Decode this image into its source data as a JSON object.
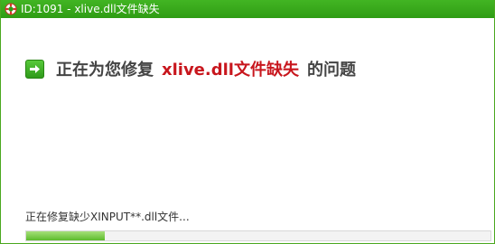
{
  "window": {
    "title": "ID:1091 - xlive.dll文件缺失",
    "app_icon": "lifebuoy-icon",
    "accent_color": "#3aa81b"
  },
  "headline": {
    "icon": "arrow-right-icon",
    "prefix": "正在为您修复",
    "highlight": "xlive.dll文件缺失",
    "suffix": "的问题",
    "highlight_color": "#c8161d"
  },
  "status": {
    "text": "正在修复缺少XINPUT**.dll文件..."
  },
  "progress": {
    "fraction": 0.17
  }
}
